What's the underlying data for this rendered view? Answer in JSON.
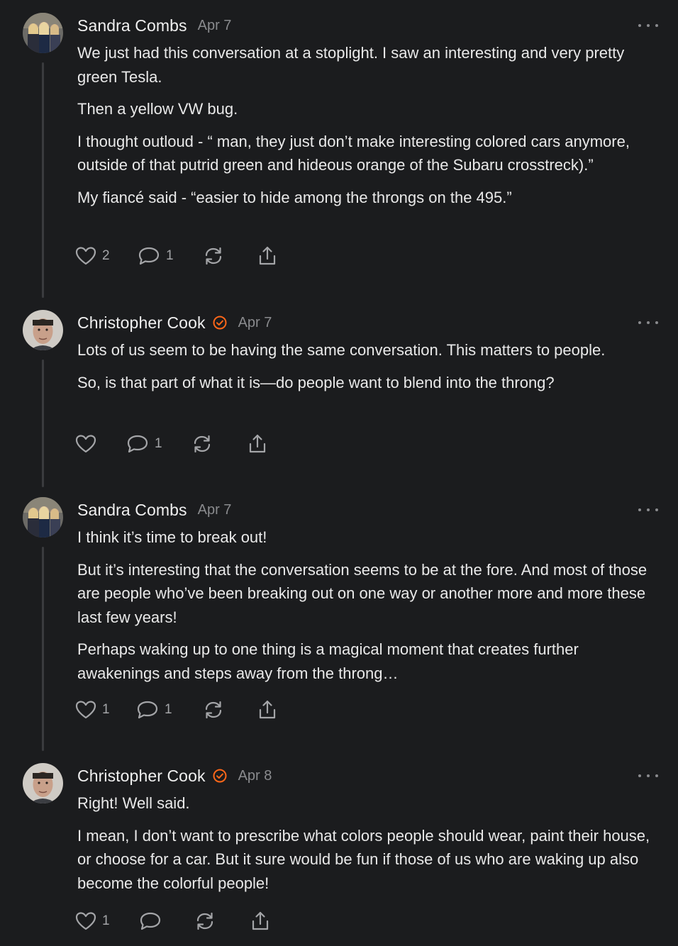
{
  "comments": [
    {
      "author": "Sandra Combs",
      "verified": false,
      "date": "Apr 7",
      "paragraphs": [
        "We just had this conversation at a stoplight. I saw an interesting and very pretty green Tesla.",
        "Then a yellow VW bug.",
        "I thought outloud - “ man, they just don’t make interesting colored cars anymore, outside of that putrid green and hideous orange of the Subaru crosstreck).”",
        "My fiancé said - “easier to hide among the throngs on the 495.”"
      ],
      "likes": "2",
      "replies": "1"
    },
    {
      "author": "Christopher Cook",
      "verified": true,
      "date": "Apr 7",
      "paragraphs": [
        "Lots of us seem to be having the same conversation. This matters to people.",
        "So, is that part of what it is—do people want to blend into the throng?"
      ],
      "likes": "",
      "replies": "1"
    },
    {
      "author": "Sandra Combs",
      "verified": false,
      "date": "Apr 7",
      "paragraphs": [
        "I think it’s time to break out!",
        "But it’s interesting that the conversation seems to be at the fore. And most of those are people who’ve been breaking out on one way or another more and more these last few years!",
        "Perhaps waking up to one thing is a magical moment that creates further awakenings and steps away from the throng…"
      ],
      "likes": "1",
      "replies": "1"
    },
    {
      "author": "Christopher Cook",
      "verified": true,
      "date": "Apr 8",
      "paragraphs": [
        "Right! Well said.",
        "I mean, I don’t want to prescribe what colors people should wear, paint their house, or choose for a car. But it sure would be fun if those of us who are waking up also become the colorful people!"
      ],
      "likes": "1",
      "replies": ""
    }
  ],
  "icons": {
    "like": "heart-icon",
    "reply": "speech-bubble-icon",
    "restack": "restack-arrows-icon",
    "share": "share-upload-icon",
    "more": "ellipsis-icon",
    "verified": "checkmark-badge-icon"
  },
  "colors": {
    "background": "#1b1c1e",
    "text": "#e9e9e9",
    "muted": "#8a8b8e",
    "accent_verified": "#ff6719"
  }
}
